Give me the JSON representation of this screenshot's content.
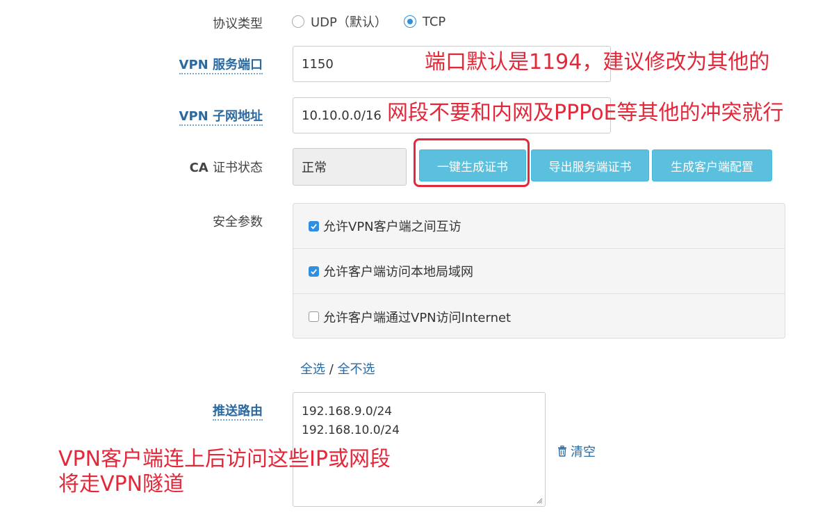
{
  "form": {
    "protocol_label": "协议类型",
    "protocol_options": [
      {
        "label": "UDP（默认）",
        "selected": false
      },
      {
        "label": "TCP",
        "selected": true
      }
    ],
    "port_label_prefix": "VPN",
    "port_label_suffix": "服务端口",
    "port_value": "1150",
    "subnet_label_prefix": "VPN",
    "subnet_label_suffix": "子网地址",
    "subnet_value": "10.10.0.0/16",
    "ca_label_prefix": "CA",
    "ca_label_suffix": "证书状态",
    "ca_status_value": "正常",
    "buttons": {
      "generate_cert": "一键生成证书",
      "export_server_cert": "导出服务端证书",
      "generate_client_config": "生成客户端配置"
    },
    "security_label": "安全参数",
    "security_options": [
      {
        "label": "允许VPN客户端之间互访",
        "checked": true
      },
      {
        "label": "允许客户端访问本地局域网",
        "checked": true
      },
      {
        "label": "允许客户端通过VPN访问Internet",
        "checked": false
      }
    ],
    "select_all": "全选",
    "separator": "/",
    "select_none": "全不选",
    "push_routes_label": "推送路由",
    "push_routes": [
      "192.168.9.0/24",
      "192.168.10.0/24"
    ],
    "clear_label": "清空"
  },
  "annotations": {
    "port_note": "端口默认是1194，建议修改为其他的",
    "subnet_note": "网段不要和内网及PPPoE等其他的冲突就行",
    "route_note_line1": "VPN客户端连上后访问这些IP或网段",
    "route_note_line2": "将走VPN隧道"
  },
  "colors": {
    "button": "#5bc0de",
    "link": "#2a6aa0",
    "annotation": "#e4283a",
    "accent": "#2f8fe0"
  }
}
